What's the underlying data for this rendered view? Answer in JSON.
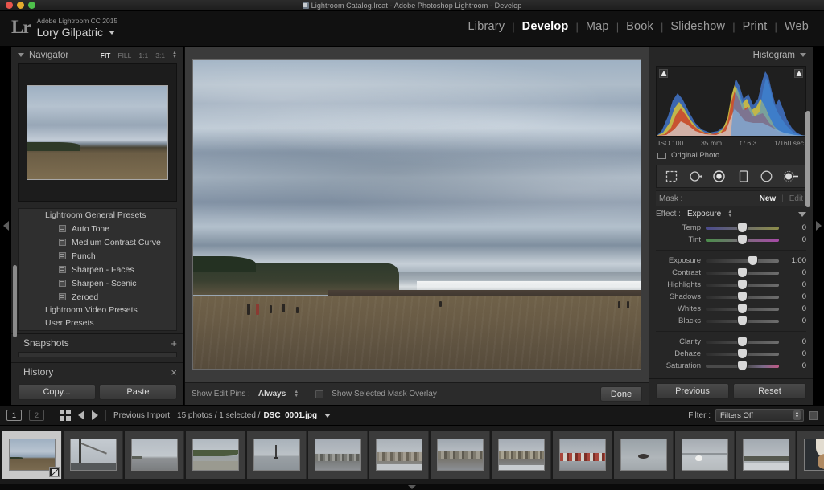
{
  "window": {
    "title": "Lightroom Catalog.lrcat - Adobe Photoshop Lightroom - Develop",
    "doc_icon": "lightroom-document-icon"
  },
  "identity": {
    "logo": "Lr",
    "product": "Adobe Lightroom CC 2015",
    "user": "Lory Gilpatric",
    "dropdown_icon": "chevron-down-icon"
  },
  "modules": [
    {
      "label": "Library",
      "active": false
    },
    {
      "label": "Develop",
      "active": true
    },
    {
      "label": "Map",
      "active": false
    },
    {
      "label": "Book",
      "active": false
    },
    {
      "label": "Slideshow",
      "active": false
    },
    {
      "label": "Print",
      "active": false
    },
    {
      "label": "Web",
      "active": false
    }
  ],
  "module_separator": "|",
  "navigator": {
    "title": "Navigator",
    "zoom_levels": [
      {
        "label": "FIT",
        "active": true
      },
      {
        "label": "FILL",
        "active": false
      },
      {
        "label": "1:1",
        "active": false
      },
      {
        "label": "3:1",
        "active": false
      }
    ]
  },
  "presets": {
    "groups": [
      {
        "label": "Lightroom General Presets",
        "expanded": true,
        "items": [
          "Auto Tone",
          "Medium Contrast Curve",
          "Punch",
          "Sharpen - Faces",
          "Sharpen - Scenic",
          "Zeroed"
        ]
      },
      {
        "label": "Lightroom Video Presets",
        "expanded": false,
        "items": []
      },
      {
        "label": "User Presets",
        "expanded": false,
        "items": []
      }
    ]
  },
  "snapshots": {
    "title": "Snapshots",
    "action": "+"
  },
  "history": {
    "title": "History",
    "action": "×"
  },
  "left_buttons": {
    "copy": "Copy...",
    "paste": "Paste"
  },
  "toolbar": {
    "show_edit_pins_label": "Show Edit Pins :",
    "show_edit_pins_value": "Always",
    "mask_overlay_label": "Show Selected Mask Overlay",
    "mask_overlay_checked": false,
    "done": "Done"
  },
  "histogram": {
    "title": "Histogram",
    "iso": "ISO 100",
    "focal": "35 mm",
    "aperture": "f / 6.3",
    "shutter": "1/160 sec",
    "original_photo": "Original Photo"
  },
  "tools": [
    {
      "name": "crop-overlay-icon"
    },
    {
      "name": "spot-removal-icon"
    },
    {
      "name": "red-eye-correction-icon"
    },
    {
      "name": "graduated-filter-icon"
    },
    {
      "name": "radial-filter-icon"
    },
    {
      "name": "adjustment-brush-icon"
    }
  ],
  "mask": {
    "label": "Mask :",
    "new": "New",
    "separator": "|",
    "edit": "Edit"
  },
  "effect": {
    "label": "Effect :",
    "value": "Exposure"
  },
  "sliders": {
    "white_balance": [
      {
        "label": "Temp",
        "value": "0",
        "pos": 50,
        "track": "temp"
      },
      {
        "label": "Tint",
        "value": "0",
        "pos": 50,
        "track": "tint"
      }
    ],
    "tone": [
      {
        "label": "Exposure",
        "value": "1.00",
        "pos": 64,
        "track": "grey"
      },
      {
        "label": "Contrast",
        "value": "0",
        "pos": 50,
        "track": "grey"
      },
      {
        "label": "Highlights",
        "value": "0",
        "pos": 50,
        "track": "grey"
      },
      {
        "label": "Shadows",
        "value": "0",
        "pos": 50,
        "track": "grey"
      },
      {
        "label": "Whites",
        "value": "0",
        "pos": 50,
        "track": "grey"
      },
      {
        "label": "Blacks",
        "value": "0",
        "pos": 50,
        "track": "grey"
      }
    ],
    "presence": [
      {
        "label": "Clarity",
        "value": "0",
        "pos": 50,
        "track": "grey"
      },
      {
        "label": "Dehaze",
        "value": "0",
        "pos": 50,
        "track": "grey"
      },
      {
        "label": "Saturation",
        "value": "0",
        "pos": 50,
        "track": "sat"
      }
    ]
  },
  "right_buttons": {
    "previous": "Previous",
    "reset": "Reset"
  },
  "filmbar": {
    "page_1": "1",
    "page_2": "2",
    "grid_icon": "grid-view-icon",
    "prev_icon": "arrow-left-icon",
    "next_icon": "arrow-right-icon",
    "source": "Previous Import",
    "status": "15 photos / 1 selected /",
    "filename": "DSC_0001.jpg",
    "filename_caret": "chevron-down-icon",
    "filter_label": "Filter :",
    "filter_value": "Filters Off"
  },
  "filmstrip": {
    "thumbnails": [
      {
        "name": "beach-cliff-sand",
        "selected": true,
        "sky": "#9fb0c2",
        "land": "#2f3a28",
        "sand": "#6b5c44",
        "kind": "beach"
      },
      {
        "name": "boat-mast-rigging",
        "selected": false,
        "sky": "#b8bec4",
        "land": "#3a3a38",
        "sand": "#55585a",
        "kind": "mast"
      },
      {
        "name": "shoreline-distant",
        "selected": false,
        "sky": "#aeb6bd",
        "land": "#6a6e70",
        "sand": "#8a8d8e",
        "kind": "shore"
      },
      {
        "name": "beach-hillside",
        "selected": false,
        "sky": "#b2bac1",
        "land": "#4c5a3e",
        "sand": "#8f8f88",
        "kind": "hill"
      },
      {
        "name": "sailboat-horizon",
        "selected": false,
        "sky": "#a9b2ba",
        "land": "#7e848a",
        "sand": "#9aa0a5",
        "kind": "boat"
      },
      {
        "name": "harbor-boats-1",
        "selected": false,
        "sky": "#a7aeb6",
        "land": "#6d6f6c",
        "sand": "#8d9094",
        "kind": "harbor"
      },
      {
        "name": "harbor-boats-2",
        "selected": false,
        "sky": "#aab1b8",
        "land": "#7a7468",
        "sand": "#909497",
        "kind": "harbor"
      },
      {
        "name": "harbor-boats-3",
        "selected": false,
        "sky": "#9fa7af",
        "land": "#6f6a5e",
        "sand": "#8b8f94",
        "kind": "harbor"
      },
      {
        "name": "harbor-boats-4",
        "selected": false,
        "sky": "#a5acb4",
        "land": "#6b665c",
        "sand": "#8e9298",
        "kind": "harbor"
      },
      {
        "name": "harbor-red-boats",
        "selected": false,
        "sky": "#9ea6ae",
        "land": "#8a4a42",
        "sand": "#8a8e93",
        "kind": "harbor"
      },
      {
        "name": "sea-otter-water",
        "selected": false,
        "sky": "#9aa2a8",
        "land": "#3a3634",
        "sand": "#a2a8ac",
        "kind": "otter"
      },
      {
        "name": "seagull-on-shore",
        "selected": false,
        "sky": "#a6acb2",
        "land": "#7d8288",
        "sand": "#b6bbbe",
        "kind": "gull"
      },
      {
        "name": "pier-distant-view",
        "selected": false,
        "sky": "#a3aab1",
        "land": "#55584f",
        "sand": "#9da2a6",
        "kind": "pier"
      },
      {
        "name": "pelican-closeup",
        "selected": false,
        "sky": "#2b2f33",
        "land": "#d8d2c6",
        "sand": "#9a7a5c",
        "kind": "pelican"
      },
      {
        "name": "bird-in-flight",
        "selected": false,
        "sky": "#c3cad1",
        "land": "#6a6f74",
        "sand": "#c8ced3",
        "kind": "flight"
      }
    ]
  },
  "colors": {
    "panel_bg": "#262626",
    "canvas_bg": "#3b3b3b",
    "accent_text": "#ffffff",
    "muted_text": "#9b9b9b"
  }
}
